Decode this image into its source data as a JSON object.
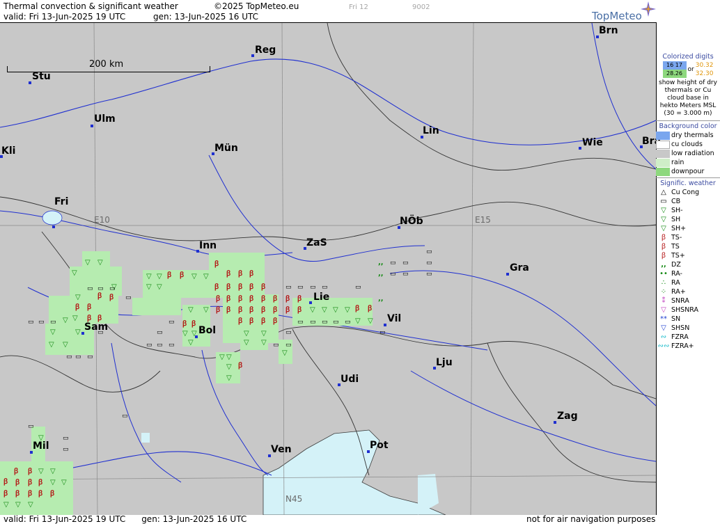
{
  "header": {
    "title": "Thermal convection & significant weather",
    "copyright": "©2025 TopMeteo.eu",
    "valid": "valid:  Fri  13-Jun-2025  19 UTC",
    "gen": "gen: 13-Jun-2025 16 UTC",
    "day": "Fri 12",
    "code": "9002",
    "logo": "TopMeteo"
  },
  "map": {
    "scale_label": "200 km",
    "grid_labels": {
      "e10": "E10",
      "e15": "E15",
      "n45": "N45"
    },
    "cities": {
      "brn": "Brn",
      "reg": "Reg",
      "stu": "Stu",
      "ulm": "Ulm",
      "lin": "Lin",
      "kli": "Kli",
      "mun": "Mün",
      "wie": "Wie",
      "bra": "Bra",
      "fri": "Fri",
      "nob": "NÖb",
      "inn": "Inn",
      "zas": "ZaS",
      "gra": "Gra",
      "lie": "Lie",
      "vil": "Vil",
      "sam": "Sam",
      "bol": "Bol",
      "lju": "Lju",
      "udi": "Udi",
      "zag": "Zag",
      "mil": "Mil",
      "ven": "Ven",
      "pot": "Pot"
    }
  },
  "legend": {
    "digits_title": "Colorized digits",
    "digits_a": "16  17",
    "digits_b": "28.26",
    "digits_or": "or",
    "digits_c": "30.32",
    "digits_d": "32.30",
    "digits_desc": "show height of dry thermals or Cu cloud base in hekto Meters MSL (30 = 3.000 m)",
    "bg_title": "Background color",
    "bg_items": [
      "dry thermals",
      "cu clouds",
      "low radiation",
      "rain",
      "downpour"
    ],
    "bg_colors": [
      "#7aa6ee",
      "#ffffff",
      "#c8c8c8",
      "#cfeec8",
      "#8ed87e"
    ],
    "wx_title": "Signific. weather",
    "wx_items": [
      "Cu Cong",
      "CB",
      "SH-",
      "SH",
      "SH+",
      "TS-",
      "TS",
      "TS+",
      "DZ",
      "RA-",
      "RA",
      "RA+",
      "SNRA",
      "SHSNRA",
      "SN",
      "SHSN",
      "FZRA",
      "FZRA+"
    ]
  },
  "footer": {
    "valid": "valid:  Fri  13-Jun-2025  19 UTC",
    "gen": "gen: 13-Jun-2025 16 UTC",
    "disclaimer": "not for air navigation purposes"
  }
}
